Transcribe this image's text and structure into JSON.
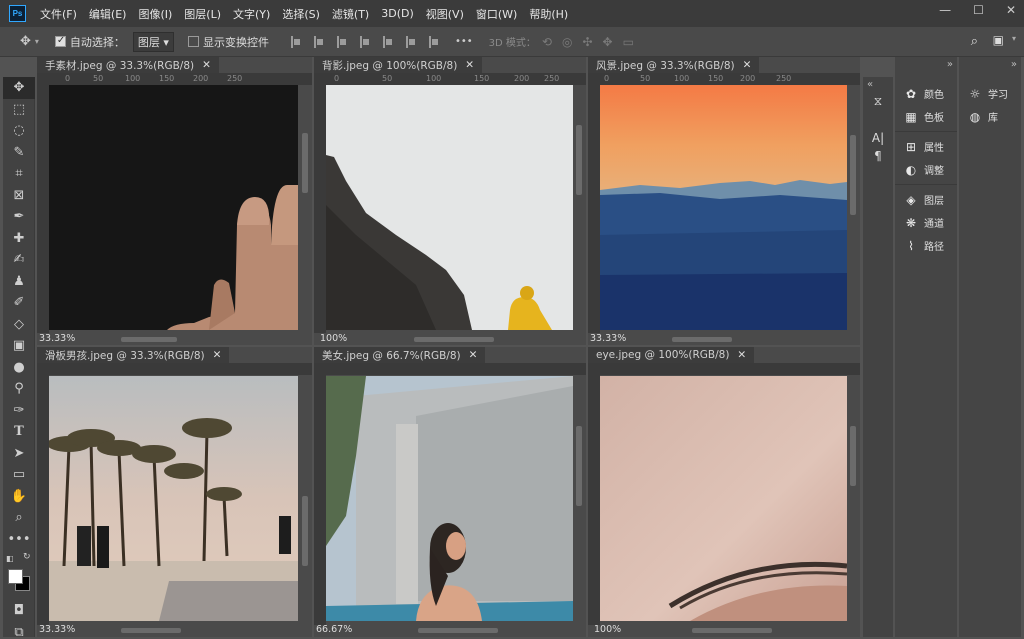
{
  "app": {
    "logo": "Ps"
  },
  "menu": [
    "文件(F)",
    "编辑(E)",
    "图像(I)",
    "图层(L)",
    "文字(Y)",
    "选择(S)",
    "滤镜(T)",
    "3D(D)",
    "视图(V)",
    "窗口(W)",
    "帮助(H)"
  ],
  "window_controls": {
    "minimize": "—",
    "restore": "☐",
    "close": "✕"
  },
  "options": {
    "auto_select_label": "自动选择：",
    "auto_select_value": "图层",
    "show_transform_label": "显示变换控件",
    "mode_3d_label": "3D 模式：",
    "more": "•••"
  },
  "tools": [
    "move-tool",
    "marquee-tool",
    "lasso-tool",
    "quick-select-tool",
    "crop-tool",
    "frame-tool",
    "eyedropper-tool",
    "healing-brush-tool",
    "brush-tool",
    "clone-stamp-tool",
    "history-brush-tool",
    "eraser-tool",
    "gradient-tool",
    "blur-tool",
    "dodge-tool",
    "pen-tool",
    "type-tool",
    "path-select-tool",
    "rectangle-tool",
    "hand-tool",
    "zoom-tool",
    "more-tools"
  ],
  "documents": [
    {
      "tab": "手素材.jpeg @ 33.3%(RGB/8)",
      "zoom": "33.33%",
      "close": "✕"
    },
    {
      "tab": "背影.jpeg @ 100%(RGB/8)",
      "zoom": "100%",
      "close": "✕"
    },
    {
      "tab": "风景.jpeg @ 33.3%(RGB/8)",
      "zoom": "33.33%",
      "close": "✕"
    },
    {
      "tab": "滑板男孩.jpeg @ 33.3%(RGB/8)",
      "zoom": "33.33%",
      "close": "✕"
    },
    {
      "tab": "美女.jpeg @ 66.7%(RGB/8)",
      "zoom": "66.67%",
      "close": "✕"
    },
    {
      "tab": "eye.jpeg @ 100%(RGB/8)",
      "zoom": "100%",
      "close": "✕"
    }
  ],
  "ruler_ticks": [
    "0",
    "50",
    "100",
    "150",
    "200",
    "250"
  ],
  "panels": {
    "group1": [
      {
        "label": "颜色",
        "icon": "palette-icon"
      },
      {
        "label": "色板",
        "icon": "swatches-icon"
      }
    ],
    "group2": [
      {
        "label": "属性",
        "icon": "properties-icon"
      },
      {
        "label": "调整",
        "icon": "adjustments-icon"
      }
    ],
    "group3": [
      {
        "label": "图层",
        "icon": "layers-icon"
      },
      {
        "label": "通道",
        "icon": "channels-icon"
      },
      {
        "label": "路径",
        "icon": "paths-icon"
      }
    ],
    "group4": [
      {
        "label": "学习",
        "icon": "learn-icon"
      },
      {
        "label": "库",
        "icon": "libraries-icon"
      }
    ]
  }
}
